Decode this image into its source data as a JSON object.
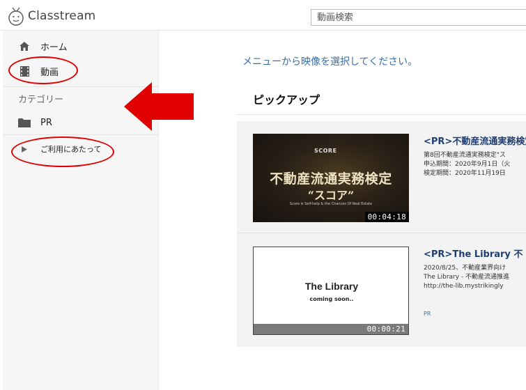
{
  "header": {
    "logo_text": "Classtream",
    "search": {
      "placeholder": "動画検索"
    }
  },
  "sidebar": {
    "home_label": "ホーム",
    "videos_label": "動画",
    "category_heading": "カテゴリー",
    "pr_label": "PR",
    "usage_label": "ご利用にあたって"
  },
  "main": {
    "message": "メニューから映像を選択してください。",
    "section_title": "ピックアップ",
    "videos": [
      {
        "title": "<PR>不動産流通実務検定",
        "description": "第8回不動産流通実務検定\"ス\n申込期間：2020年9月1日（火\n検定期間：2020年11月19日",
        "duration": "00:04:18",
        "thumb_brand": "SCORE",
        "thumb_title": "不動産流通実務検定",
        "thumb_subtitle": "“スコア”",
        "thumb_tagline": "Score is Self-help & the Chances Of Real Estate"
      },
      {
        "title": "<PR>The Library 不",
        "description": "2020/8/25、不動産業界向け\nThe Library - 不動産流通推進\nhttp://the-lib.mystrikingly",
        "category": "PR",
        "duration": "00:00:21",
        "thumb_title": "The Library",
        "thumb_subtitle": "coming soon.."
      }
    ]
  },
  "colors": {
    "accent_link": "#3a6ea5",
    "title_navy": "#1f3f73",
    "annotation_red": "#e00000"
  },
  "icons": [
    "clock-mascot-icon",
    "home-icon",
    "film-icon",
    "folder-icon",
    "triangle-right-icon"
  ]
}
